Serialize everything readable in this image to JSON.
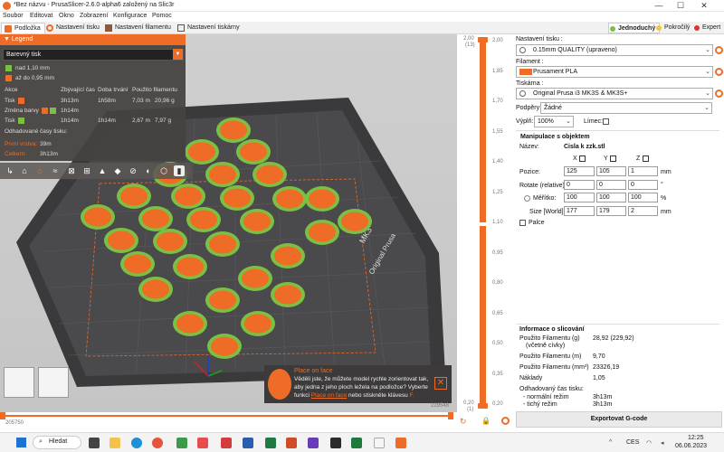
{
  "window": {
    "title": "*Bez názvu - PrusaSlicer-2.6.0-alpha6 založený na Slic3r",
    "min": "—",
    "max": "☐",
    "close": "✕"
  },
  "menu": [
    "Soubor",
    "Editovat",
    "Okno",
    "Zobrazení",
    "Konfigurace",
    "Pomoc"
  ],
  "tabs": [
    "Podložka",
    "Nastavení tisku",
    "Nastavení filamentu",
    "Nastavení tiskárny"
  ],
  "modes": [
    "Jednoduchý",
    "Pokročilý",
    "Expert"
  ],
  "mode_colors": [
    "#7bc043",
    "#f0c83c",
    "#e0352b"
  ],
  "accent": "#ee6c25",
  "legend": {
    "header": "Legend",
    "view_type": "Barevný tisk",
    "ranges": [
      {
        "label": "nad 1,10 mm",
        "color": "#7bc043"
      },
      {
        "label": "až do 0,95 mm",
        "color": "#ee6c25"
      }
    ],
    "columns": [
      "Akce",
      "Zbývající čas",
      "Doba trvání",
      "Použito filamentu"
    ],
    "rows": [
      {
        "action": "Tisk",
        "remaining": "3h13m",
        "duration": "1h58m",
        "length": "7,03 m",
        "weight": "20,96 g"
      },
      {
        "action": "Změna barvy",
        "remaining": "1h14m",
        "duration": "",
        "length": "",
        "weight": ""
      },
      {
        "action": "Tisk",
        "remaining": "1h14m",
        "duration": "1h14m",
        "length": "2,67 m",
        "weight": "7,97 g"
      }
    ],
    "estimated_label": "Odhadované časy tisku:",
    "first_layer_label": "První vrstva:",
    "first_layer_value": "39m",
    "total_label": "Celkem:",
    "total_value": "3h13m"
  },
  "bed": {
    "brand_line1": "MK3",
    "brand_line2": "Original Prusa"
  },
  "vslider": {
    "top_value": "2,00",
    "top_layer": "(13)",
    "bottom_value": "0,20",
    "bottom_layer": "(1)",
    "ticks": [
      "2,00",
      "1,85",
      "1,70",
      "1,55",
      "1,40",
      "1,25",
      "1,10",
      "0,95",
      "0,80",
      "0,65",
      "0,50",
      "0,35",
      "0,20"
    ]
  },
  "hslider": {
    "left": "205750",
    "right": "229548"
  },
  "toast": {
    "title": "Place on face",
    "text1": "Věděli jste, že můžete model rychle zorientovat tak,",
    "text2": "aby jedna z jeho ploch ležela na podložce? Vyberte",
    "text3a": "funkci",
    "link": "Place on face",
    "text3b": "nebo stiskněte klávesu",
    "key": "F."
  },
  "right": {
    "print_label": "Nastavení tisku :",
    "print_value": "0.15mm QUALITY (upraveno)",
    "filament_label": "Filament :",
    "filament_value": "Prusament PLA",
    "printer_label": "Tiskárna :",
    "printer_value": "Original Prusa i3 MK3S & MK3S+",
    "supports_label": "Podpěry:",
    "supports_value": "Žádné",
    "infill_label": "Výplň:",
    "infill_value": "100%",
    "brim_label": "Límec:",
    "manip_title": "Manipulace s objektem",
    "name_label": "Název:",
    "name_value": "Cisla k zzk.stl",
    "axes": [
      "X",
      "Y",
      "Z"
    ],
    "pos_label": "Pozice:",
    "pos": [
      "125",
      "105",
      "1"
    ],
    "rot_label": "Rotate (relative):",
    "rot": [
      "0",
      "0",
      "0"
    ],
    "scale_label": "Měřítko:",
    "scale": [
      "100",
      "100",
      "100"
    ],
    "size_label": "Size [World]:",
    "size": [
      "177",
      "179",
      "2"
    ],
    "unit_mm": "mm",
    "unit_deg": "°",
    "unit_pct": "%",
    "inches_label": "Palce",
    "info_title": "Informace o slicování",
    "info": [
      {
        "label": "Použito Filamentu (g)",
        "sub": "(včetně cívky)",
        "value": "28,92 (229,92)"
      },
      {
        "label": "Použito Filamentu (m)",
        "sub": "",
        "value": "9,70"
      },
      {
        "label": "Použito Filamentu (mm³)",
        "sub": "",
        "value": "23326,19"
      },
      {
        "label": "Náklady",
        "sub": "",
        "value": "1,05"
      }
    ],
    "est_label": "Odhadovaný čas tisku:",
    "normal_label": "- normální režim",
    "normal_value": "3h13m",
    "silent_label": "- tichý režim",
    "silent_value": "3h13m",
    "export_label": "Exportovat G-code"
  },
  "taskbar": {
    "search": "Hledat",
    "lang": "CES",
    "time": "12:25",
    "date": "06.06.2023"
  }
}
